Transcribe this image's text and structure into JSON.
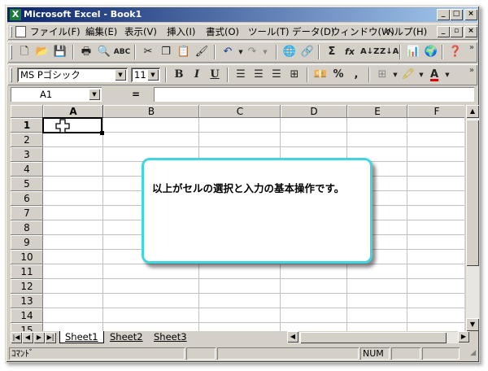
{
  "window": {
    "title": "Microsoft Excel - Book1",
    "app_icon": "excel-icon",
    "controls": [
      "minimize",
      "maximize",
      "close"
    ]
  },
  "menus": [
    "ファイル(F)",
    "編集(E)",
    "表示(V)",
    "挿入(I)",
    "書式(O)",
    "ツール(T)",
    "データ(D)",
    "ウィンドウ(W)",
    "ヘルプ(H)"
  ],
  "standard_toolbar": {
    "icons": [
      "new-icon",
      "open-icon",
      "save-icon",
      "print-icon",
      "print-preview-icon",
      "spelling-icon",
      "cut-icon",
      "copy-icon",
      "paste-icon",
      "format-painter-icon",
      "undo-icon",
      "redo-icon",
      "hyperlink-icon",
      "web-toolbar-icon",
      "autosum-icon",
      "function-icon",
      "sort-ascending-icon",
      "sort-descending-icon",
      "chart-wizard-icon",
      "map-icon",
      "office-assistant-icon"
    ],
    "autosum_glyph": "Σ",
    "function_glyph": "fx"
  },
  "formatting_toolbar": {
    "font_name": "MS Pゴシック",
    "font_size": "11",
    "bold": "B",
    "italic": "I",
    "underline": "U",
    "percent": "%",
    "comma": ",",
    "font_color_glyph": "A"
  },
  "formula_bar": {
    "name_box": "A1",
    "equals": "=",
    "formula": ""
  },
  "sheet": {
    "columns": [
      "A",
      "B",
      "C",
      "D",
      "E",
      "F"
    ],
    "rows": [
      "1",
      "2",
      "3",
      "4",
      "5",
      "6",
      "7",
      "8",
      "9",
      "10",
      "11",
      "12",
      "13",
      "14",
      "15"
    ],
    "active_cell": "A1"
  },
  "tabs": [
    "Sheet1",
    "Sheet2",
    "Sheet3"
  ],
  "active_tab": "Sheet1",
  "status": {
    "mode": "ｺﾏﾝﾄﾞ",
    "num": "NUM"
  },
  "callout": {
    "text": "以上がセルの選択と入力の基本操作です。",
    "border_color": "#3fd6df"
  },
  "colors": {
    "title_start": "#0a246a",
    "title_end": "#a6caf0",
    "face": "#d4d0c8"
  }
}
